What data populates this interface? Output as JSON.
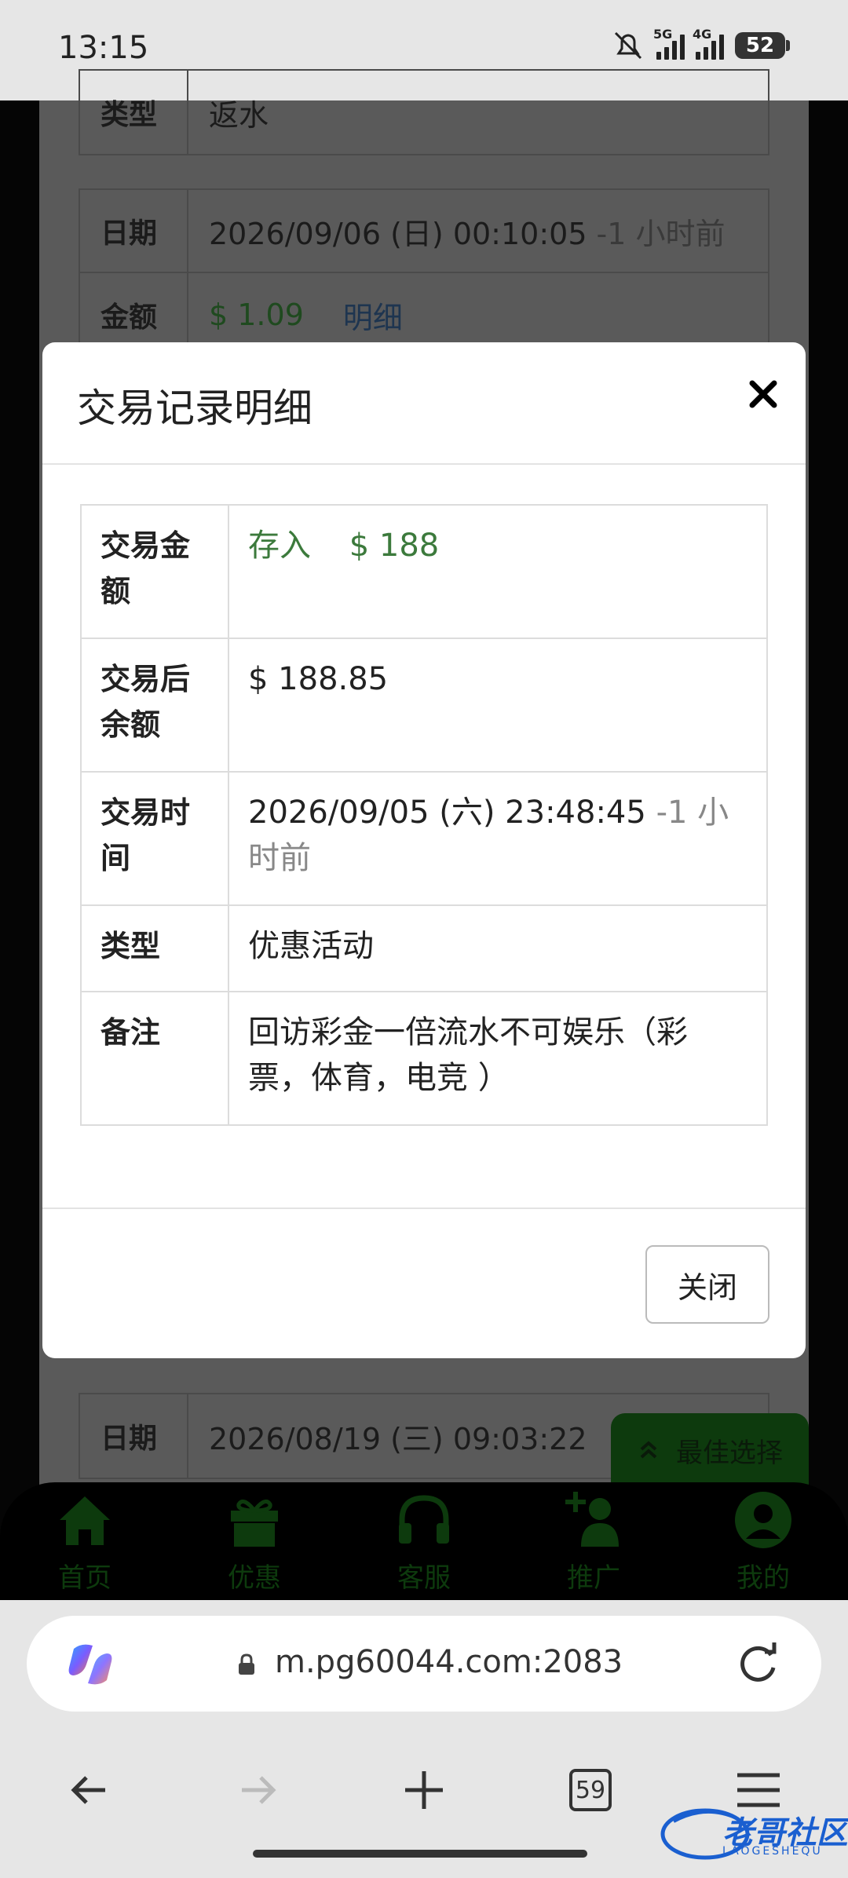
{
  "status": {
    "time": "13:15",
    "signal1_label": "5G",
    "signal2_label": "4G",
    "battery": "52"
  },
  "background_page": {
    "row_top_partial": {
      "key": "类型",
      "value": "返水"
    },
    "record1": {
      "date_key": "日期",
      "date_value": "2026/09/06 (日) 00:10:05",
      "date_rel": "-1 小时前",
      "amount_key": "金额",
      "amount_value": "$ 1.09",
      "detail_link": "明细"
    },
    "record2": {
      "date_key": "日期",
      "date_value": "2026/08/19 (三) 09:03:22"
    },
    "float_button": "最佳选择",
    "nav": [
      {
        "label": "首页",
        "icon": "home-icon"
      },
      {
        "label": "优惠",
        "icon": "gift-icon"
      },
      {
        "label": "客服",
        "icon": "headset-icon"
      },
      {
        "label": "推广",
        "icon": "add-user-icon"
      },
      {
        "label": "我的",
        "icon": "user-icon"
      }
    ]
  },
  "modal": {
    "title": "交易记录明细",
    "rows": [
      {
        "key": "交易金额",
        "value_type": "存入",
        "value_amount": "$ 188"
      },
      {
        "key": "交易后余额",
        "value": "$ 188.85"
      },
      {
        "key": "交易时间",
        "value": "2026/09/05 (六) 23:48:45",
        "rel": "-1 小时前"
      },
      {
        "key": "类型",
        "value": "优惠活动"
      },
      {
        "key": "备注",
        "value": "回访彩金一倍流水不可娱乐（彩票，体育，电竞 ）"
      }
    ],
    "close_label": "关闭"
  },
  "browser": {
    "url": "m.pg60044.com:2083",
    "tab_count": "59"
  },
  "watermark": {
    "text": "老哥社区",
    "sub": "LAOGESHEQU"
  },
  "colors": {
    "accent_green": "#3c7a3c",
    "nav_dark_green": "#0d3a0d"
  }
}
